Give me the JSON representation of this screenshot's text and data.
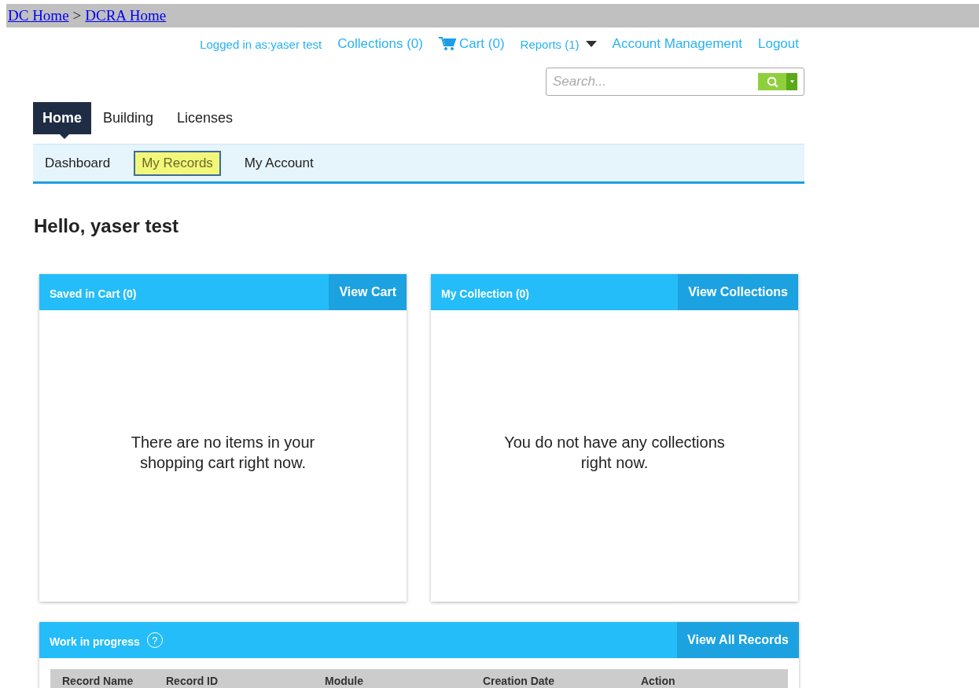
{
  "breadcrumb": [
    {
      "label": "DC Home"
    },
    {
      "label": "DCRA Home"
    }
  ],
  "breadcrumb_separator": ">",
  "top_links": [
    {
      "label": "Logged in as:yaser test",
      "kind": "text"
    },
    {
      "label": "Collections (0)",
      "kind": "link"
    },
    {
      "label": "Cart (0)",
      "kind": "cart"
    },
    {
      "label": "Reports (1)",
      "kind": "dropdown"
    },
    {
      "label": "Account Management",
      "kind": "link"
    },
    {
      "label": "Logout",
      "kind": "link"
    }
  ],
  "search": {
    "placeholder": "Search..."
  },
  "tabs": [
    {
      "label": "Home",
      "selected": true
    },
    {
      "label": "Building",
      "selected": false
    },
    {
      "label": "Licenses",
      "selected": false
    }
  ],
  "subtabs": [
    {
      "label": "Dashboard",
      "highlighted": false
    },
    {
      "label": "My Records",
      "highlighted": true
    },
    {
      "label": "My Account",
      "highlighted": false
    }
  ],
  "greeting": "Hello, yaser test",
  "panels": [
    {
      "title": "Saved in Cart (0)",
      "button": "View Cart",
      "message": "There are no items in your shopping cart right now."
    },
    {
      "title": "My Collection (0)",
      "button": "View Collections",
      "message": "You do not have any collections right now."
    }
  ],
  "work_in_progress": {
    "title": "Work in progress",
    "help": "?",
    "button": "View All Records",
    "table": {
      "columns": [
        "Record Name",
        "Record ID",
        "Module",
        "Creation Date",
        "Action"
      ]
    }
  }
}
